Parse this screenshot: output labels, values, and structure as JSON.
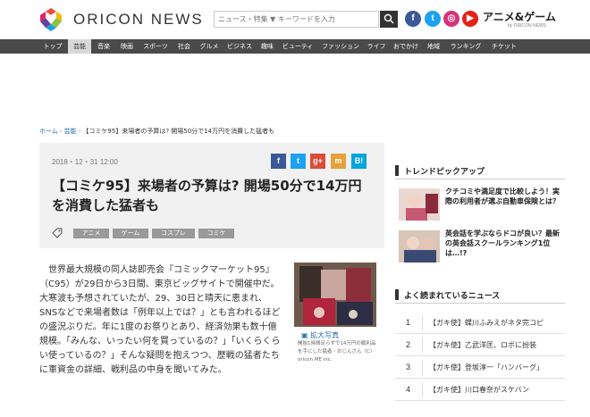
{
  "header": {
    "logo_text": "ORICON NEWS",
    "search_placeholder": "ニュース・特集 ▼ キーワードを入力",
    "social": {
      "facebook": "f",
      "twitter": "t",
      "instagram": "◎",
      "youtube": "▶"
    },
    "anime_game_label": "アニメ&ゲーム",
    "anime_game_sub": "by ORICON NEWS"
  },
  "nav": {
    "items": [
      "トップ",
      "芸能",
      "音楽",
      "映画",
      "スポーツ",
      "社会",
      "グルメ",
      "ビジネス",
      "趣味",
      "ビューティ",
      "ファッション",
      "ライフ",
      "おでかけ",
      "地域",
      "ランキング",
      "チケット"
    ],
    "active_index": 1
  },
  "breadcrumb": {
    "home": "ホーム",
    "category": "芸能",
    "current": "【コミケ95】来場者の予算は? 開場50分で14万円を消費した猛者も"
  },
  "article": {
    "date": "2018・12・31 12:00",
    "share": {
      "facebook": "f",
      "twitter": "t",
      "google": "g+",
      "mixi": "m",
      "hatena": "B!"
    },
    "title": "【コミケ95】来場者の予算は? 開場50分で14万円を消費した猛者も",
    "tags": [
      "アニメ",
      "ゲーム",
      "コスプレ",
      "コミケ"
    ],
    "body": "世界最大規模の同人誌即売会『コミックマーケット95』（C95）が29日から3日間、東京ビッグサイトで開催中だ。大寒波も予想されていたが、29、30日と晴天に恵まれ、SNSなどで来場者数は「例年以上では？」とも言われるほどの盛況ぶりだ。年に1度のお祭りとあり、経済効果も数十億規模。「みんな、いったい何を買っているの？」「いくらくらい使っているの？」そんな疑問を抱えつつ、歴戦の猛者たちに軍資金の詳細、戦利品の中身を聞いてみた。",
    "photo_link": "拡大写真",
    "photo_caption": "開始1時間足らずで14万円の戦利品を手にした猛者・おじんさん（C）oricon ME inc."
  },
  "sidebar": {
    "trend_heading": "トレンドピックアップ",
    "trend_items": [
      {
        "text": "クチコミや満足度で比較しよう！実際の利用者が選ぶ自動車保険とは？"
      },
      {
        "text": "英会話を学ぶならドコが良い？最新の英会話スクールランキング1位は…!?"
      }
    ],
    "ranking_heading": "よく読まれているニュース",
    "ranking": [
      {
        "num": "1",
        "text": "【ガキ使】蝶川ふみえがネタ完コピ"
      },
      {
        "num": "2",
        "text": "【ガキ使】乙武洋匡、ロボに扮装"
      },
      {
        "num": "3",
        "text": "【ガキ使】登坂淳一「ハンバーグ」"
      },
      {
        "num": "4",
        "text": "【ガキ使】川口春奈がスケバン"
      }
    ]
  }
}
